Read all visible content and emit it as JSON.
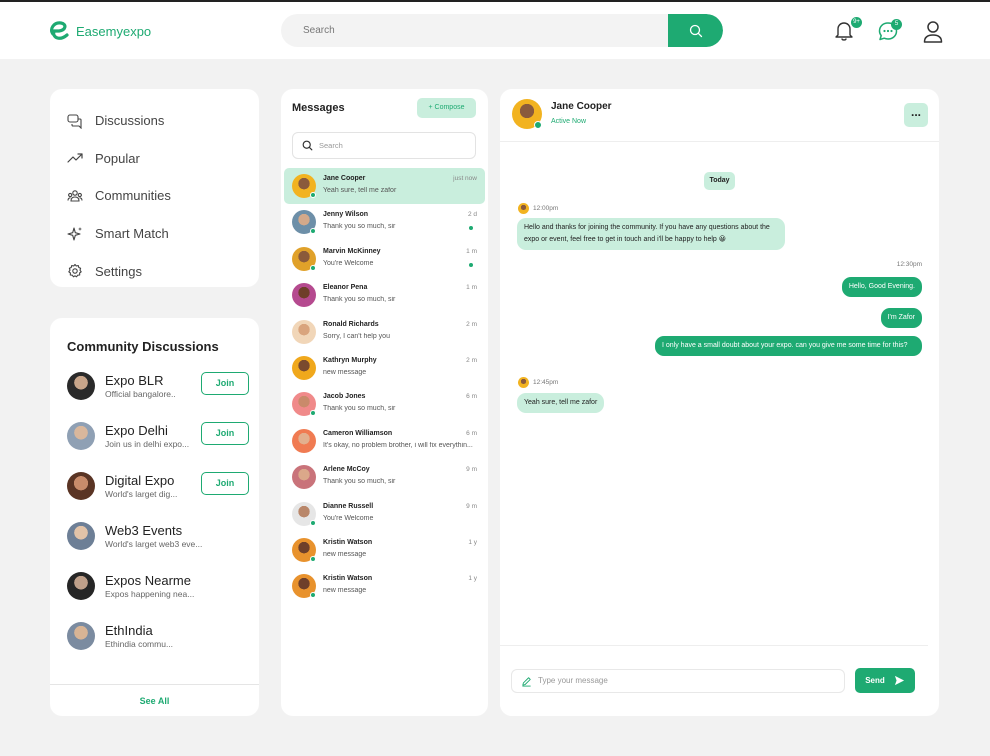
{
  "app": {
    "name": "Easemyexpo",
    "brand_color": "#1eaa72",
    "accent_light": "#c9eedd"
  },
  "header": {
    "search_placeholder": "Search",
    "notifications_count": "9+",
    "messages_count": "5",
    "icons": [
      "search-icon",
      "bell-icon",
      "chat-icon",
      "user-icon"
    ]
  },
  "nav": {
    "items": [
      {
        "label": "Discussions",
        "icon": "discussions-icon"
      },
      {
        "label": "Popular",
        "icon": "trending-icon"
      },
      {
        "label": "Communities",
        "icon": "communities-icon"
      },
      {
        "label": "Smart Match",
        "icon": "sparkle-icon"
      },
      {
        "label": "Settings",
        "icon": "gear-icon"
      }
    ]
  },
  "community": {
    "title": "Community Discussions",
    "join_label": "Join",
    "see_all": "See All",
    "items": [
      {
        "name": "Expo BLR",
        "desc": "Official bangalore..",
        "joinable": true
      },
      {
        "name": "Expo Delhi",
        "desc": "Join us in delhi expo...",
        "joinable": true
      },
      {
        "name": "Digital Expo",
        "desc": "World's larget dig...",
        "joinable": true
      },
      {
        "name": "Web3 Events",
        "desc": "World's larget web3 eve...",
        "joinable": false
      },
      {
        "name": "Expos Nearme",
        "desc": "Expos happening nea...",
        "joinable": false
      },
      {
        "name": "EthIndia",
        "desc": "Ethindia commu...",
        "joinable": false
      }
    ]
  },
  "messages": {
    "title": "Messages",
    "compose_label": "+ Compose",
    "search_placeholder": "Search",
    "list": [
      {
        "name": "Jane Cooper",
        "text": "Yeah sure, tell me zafor",
        "time": "just now",
        "online": true,
        "unread": false
      },
      {
        "name": "Jenny Wilson",
        "text": "Thank you so much, sir",
        "time": "2 d",
        "online": true,
        "unread": true
      },
      {
        "name": "Marvin McKinney",
        "text": "You're Welcome",
        "time": "1 m",
        "online": true,
        "unread": true
      },
      {
        "name": "Eleanor Pena",
        "text": "Thank you so much, sir",
        "time": "1 m",
        "online": false,
        "unread": false
      },
      {
        "name": "Ronald Richards",
        "text": "Sorry, I can't help you",
        "time": "2 m",
        "online": false,
        "unread": false
      },
      {
        "name": "Kathryn Murphy",
        "text": "new message",
        "time": "2 m",
        "online": false,
        "unread": false
      },
      {
        "name": "Jacob Jones",
        "text": "Thank you so much, sir",
        "time": "6 m",
        "online": true,
        "unread": false
      },
      {
        "name": "Cameron Williamson",
        "text": "It's okay, no problem brother, i will fix everythin...",
        "time": "6 m",
        "online": false,
        "unread": false
      },
      {
        "name": "Arlene McCoy",
        "text": "Thank you so much, sir",
        "time": "9 m",
        "online": false,
        "unread": false
      },
      {
        "name": "Dianne Russell",
        "text": "You're Welcome",
        "time": "9 m",
        "online": true,
        "unread": false
      },
      {
        "name": "Kristin Watson",
        "text": "new message",
        "time": "1 y",
        "online": true,
        "unread": false
      },
      {
        "name": "Kristin Watson",
        "text": "new message",
        "time": "1 y",
        "online": true,
        "unread": false
      }
    ]
  },
  "chat": {
    "name": "Jane Cooper",
    "status": "Active Now",
    "more_label": "...",
    "day_label": "Today",
    "stamp1": "12:00pm",
    "msg1": "Hello and thanks for joining the community. If you have any questions about the expo or event, feel free to get in touch and i'll be happy to help 😀",
    "stamp2": "12:30pm",
    "msg2": "Hello, Good Evening.",
    "msg3": "I'm Zafor",
    "msg4": "I only have a small doubt about your expo. can you give me some time for this?",
    "stamp3": "12:45pm",
    "msg5": "Yeah sure, tell me zafor",
    "input_placeholder": "Type your message",
    "send_label": "Send"
  }
}
